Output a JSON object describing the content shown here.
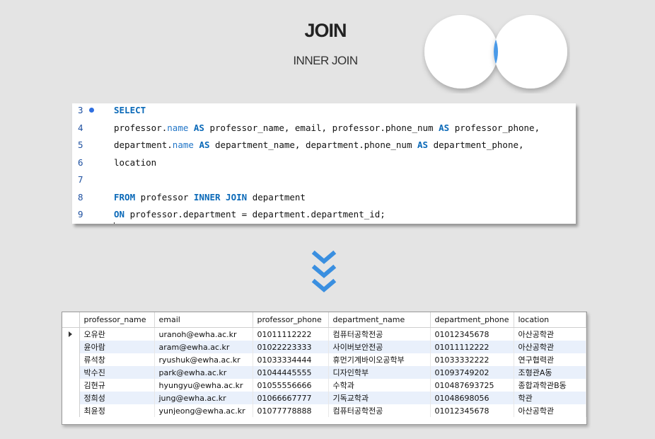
{
  "header": {
    "title": "JOIN",
    "subtitle": "INNER JOIN"
  },
  "colors": {
    "background": "#e4e4e4",
    "venn_circle": "#ffffff",
    "venn_intersection": "#4a9ae8",
    "keyword": "#0a69b8",
    "line_number": "#1e50a0",
    "arrow": "#3a8fe0",
    "row_stripe": "#e9f0fb"
  },
  "editor": {
    "lines": [
      {
        "num": "3",
        "marker": true,
        "parts": [
          {
            "t": "SELECT",
            "k": "kw"
          }
        ]
      },
      {
        "num": "4",
        "marker": false,
        "parts": [
          {
            "t": "professor."
          },
          {
            "t": "name",
            "k": "fn"
          },
          {
            "t": " "
          },
          {
            "t": "AS",
            "k": "kw"
          },
          {
            "t": " professor_name, email, professor.phone_num "
          },
          {
            "t": "AS",
            "k": "kw"
          },
          {
            "t": " professor_phone,"
          }
        ]
      },
      {
        "num": "5",
        "marker": false,
        "parts": [
          {
            "t": "department."
          },
          {
            "t": "name",
            "k": "fn"
          },
          {
            "t": " "
          },
          {
            "t": "AS",
            "k": "kw"
          },
          {
            "t": " department_name, department.phone_num "
          },
          {
            "t": "AS",
            "k": "kw"
          },
          {
            "t": " department_phone,"
          }
        ]
      },
      {
        "num": "6",
        "marker": false,
        "parts": [
          {
            "t": "location"
          }
        ]
      },
      {
        "num": "7",
        "marker": false,
        "parts": []
      },
      {
        "num": "8",
        "marker": false,
        "parts": [
          {
            "t": "FROM",
            "k": "kw"
          },
          {
            "t": " professor "
          },
          {
            "t": "INNER JOIN",
            "k": "kw"
          },
          {
            "t": " department"
          }
        ]
      },
      {
        "num": "9",
        "marker": false,
        "parts": [
          {
            "t": "ON",
            "k": "kw"
          },
          {
            "t": " professor.department = department.department_id;"
          }
        ]
      }
    ]
  },
  "results": {
    "columns": [
      "professor_name",
      "email",
      "professor_phone",
      "department_name",
      "department_phone",
      "location"
    ],
    "rows": [
      [
        "오유란",
        "uranoh@ewha.ac.kr",
        "01011112222",
        "컴퓨터공학전공",
        "01012345678",
        "아산공학관"
      ],
      [
        "윤아람",
        "aram@ewha.ac.kr",
        "01022223333",
        "사이버보안전공",
        "01011112222",
        "아산공학관"
      ],
      [
        "류석창",
        "ryushuk@ewha.ac.kr",
        "01033334444",
        "휴먼기계바이오공학부",
        "01033332222",
        "연구협력관"
      ],
      [
        "박수진",
        "park@ewha.ac.kr",
        "01044445555",
        "디자인학부",
        "01093749202",
        "조형관A동"
      ],
      [
        "김현규",
        "hyungyu@ewha.ac.kr",
        "01055556666",
        "수학과",
        "010487693725",
        "종합과학관B동"
      ],
      [
        "정희성",
        "jung@ewha.ac.kr",
        "01066667777",
        "기독교학과",
        "01048698056",
        "학관"
      ],
      [
        "최윤정",
        "yunjeong@ewha.ac.kr",
        "01077778888",
        "컴퓨터공학전공",
        "01012345678",
        "아산공학관"
      ]
    ]
  }
}
